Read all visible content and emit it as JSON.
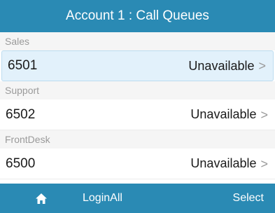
{
  "title": "Account 1 : Call Queues",
  "queues": [
    {
      "group": "Sales",
      "extension": "6501",
      "status": "Unavailable",
      "selected": true
    },
    {
      "group": "Support",
      "extension": "6502",
      "status": "Unavailable",
      "selected": false
    },
    {
      "group": "FrontDesk",
      "extension": "6500",
      "status": "Unavailable",
      "selected": false
    }
  ],
  "chevron": ">",
  "softkeys": {
    "home_icon": "home-icon",
    "middle_label": "LoginAll",
    "right_label": "Select"
  },
  "colors": {
    "accent": "#2a8ab4",
    "selected_row": "#e2f1fb",
    "group_header_bg": "#f5f5f5",
    "group_header_text": "#9a9a9a"
  }
}
